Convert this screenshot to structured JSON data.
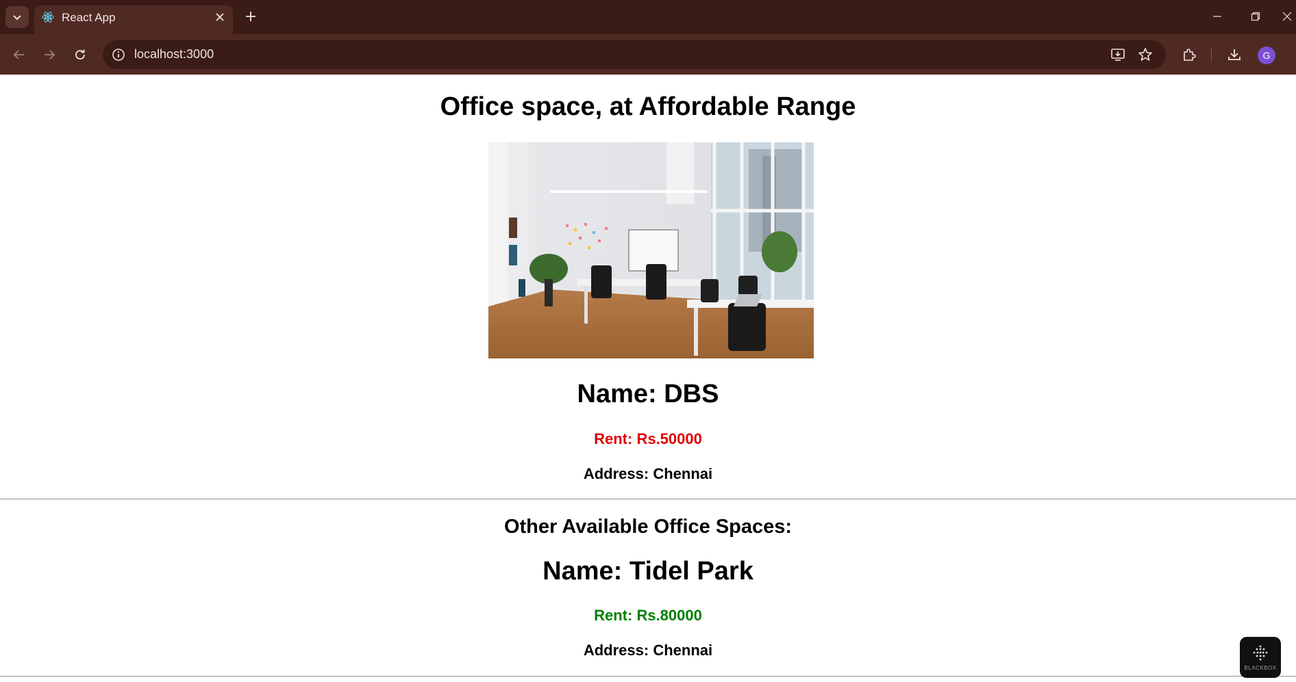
{
  "browser": {
    "tab_title": "React App",
    "url": "localhost:3000",
    "profile_initial": "G"
  },
  "page": {
    "title": "Office space, at Affordable Range",
    "featured": {
      "name": "Name: DBS",
      "rent": "Rent: Rs.50000",
      "rent_color": "#e00000",
      "address": "Address: Chennai"
    },
    "others_heading": "Other Available Office Spaces:",
    "others": [
      {
        "name": "Name: Tidel Park",
        "rent": "Rent: Rs.80000",
        "rent_color": "#008000",
        "address": "Address: Chennai"
      }
    ]
  },
  "overlay": {
    "logo_text": "BLACKBOX"
  }
}
